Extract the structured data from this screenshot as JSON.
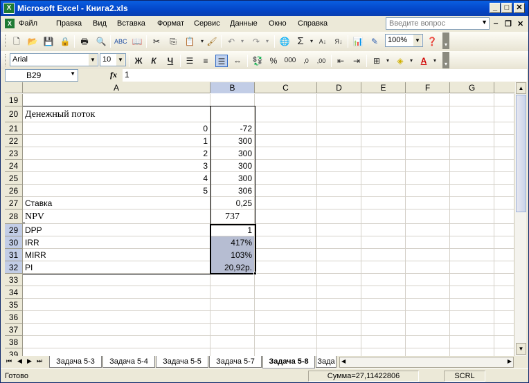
{
  "window": {
    "title": "Microsoft Excel - Книга2.xls"
  },
  "menu": {
    "items": [
      "Файл",
      "Правка",
      "Вид",
      "Вставка",
      "Формат",
      "Сервис",
      "Данные",
      "Окно",
      "Справка"
    ],
    "help_placeholder": "Введите вопрос"
  },
  "toolbar": {
    "zoom": "100%",
    "font": "Arial",
    "font_size": "10",
    "bold": "Ж",
    "italic": "К",
    "underline": "Ч",
    "percent": "%",
    "thousands": "000",
    "sum": "Σ"
  },
  "formula_bar": {
    "name_box": "B29",
    "fx": "fx",
    "value": "1"
  },
  "columns": [
    "A",
    "B",
    "C",
    "D",
    "E",
    "F",
    "G"
  ],
  "rows": [
    {
      "n": "19",
      "a": "",
      "b": ""
    },
    {
      "n": "20",
      "a": "Денежный поток",
      "b": ""
    },
    {
      "n": "21",
      "a": "0",
      "b": "-72"
    },
    {
      "n": "22",
      "a": "1",
      "b": "300"
    },
    {
      "n": "23",
      "a": "2",
      "b": "300"
    },
    {
      "n": "24",
      "a": "3",
      "b": "300"
    },
    {
      "n": "25",
      "a": "4",
      "b": "300"
    },
    {
      "n": "26",
      "a": "5",
      "b": "306"
    },
    {
      "n": "27",
      "a": "Ставка",
      "b": "0,25"
    },
    {
      "n": "28",
      "a": "NPV",
      "b": "737"
    },
    {
      "n": "29",
      "a": "DPP",
      "b": "1"
    },
    {
      "n": "30",
      "a": "IRR",
      "b": "417%"
    },
    {
      "n": "31",
      "a": "MIRR",
      "b": "103%"
    },
    {
      "n": "32",
      "a": "PI",
      "b": "20,92р."
    },
    {
      "n": "33",
      "a": "",
      "b": ""
    },
    {
      "n": "34",
      "a": "",
      "b": ""
    },
    {
      "n": "35",
      "a": "",
      "b": ""
    },
    {
      "n": "36",
      "a": "",
      "b": ""
    },
    {
      "n": "37",
      "a": "",
      "b": ""
    },
    {
      "n": "38",
      "a": "",
      "b": ""
    },
    {
      "n": "39",
      "a": "",
      "b": ""
    }
  ],
  "sheet_tabs": [
    "Задача 5-3",
    "Задача 5-4",
    "Задача 5-5",
    "Задача 5-7",
    "Задача 5-8",
    "Зада"
  ],
  "active_tab": "Задача 5-8",
  "status": {
    "ready": "Готово",
    "sum": "Сумма=27,11422806",
    "scrl": "SCRL"
  },
  "colors": {
    "title_bar": "#0346c8",
    "selection": "#b6bdd2",
    "header_selected": "#c2cde6"
  }
}
